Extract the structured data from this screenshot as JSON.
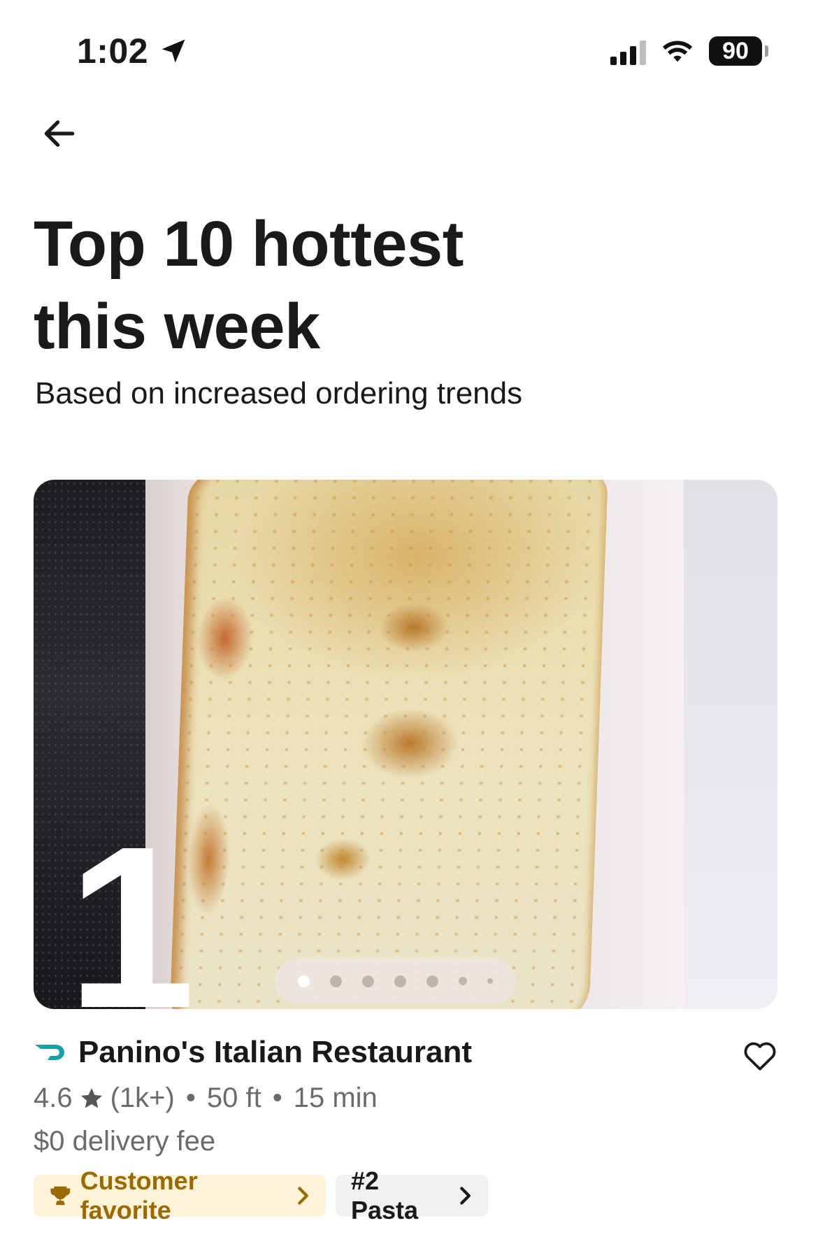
{
  "status_bar": {
    "time": "1:02",
    "battery": "90"
  },
  "header": {
    "title_line1": "Top 10 hottest",
    "title_line2": "this week",
    "subtitle": "Based on increased ordering trends"
  },
  "card": {
    "rank": "1",
    "carousel_pages": 7,
    "carousel_active": 1,
    "store_name": "Panino's Italian Restaurant",
    "rating": "4.6",
    "review_count": "(1k+)",
    "distance": "50 ft",
    "eta": "15 min",
    "separator": "•",
    "delivery_fee": "$0 delivery fee",
    "badges": [
      {
        "label": "Customer favorite",
        "icon": "trophy-icon"
      },
      {
        "label": "#2 Pasta"
      }
    ]
  },
  "colors": {
    "accent_teal": "#18a2a3",
    "favorite_bg": "#fff4d8",
    "favorite_text": "#9a6a00",
    "secondary_text": "#6b6b6b"
  }
}
